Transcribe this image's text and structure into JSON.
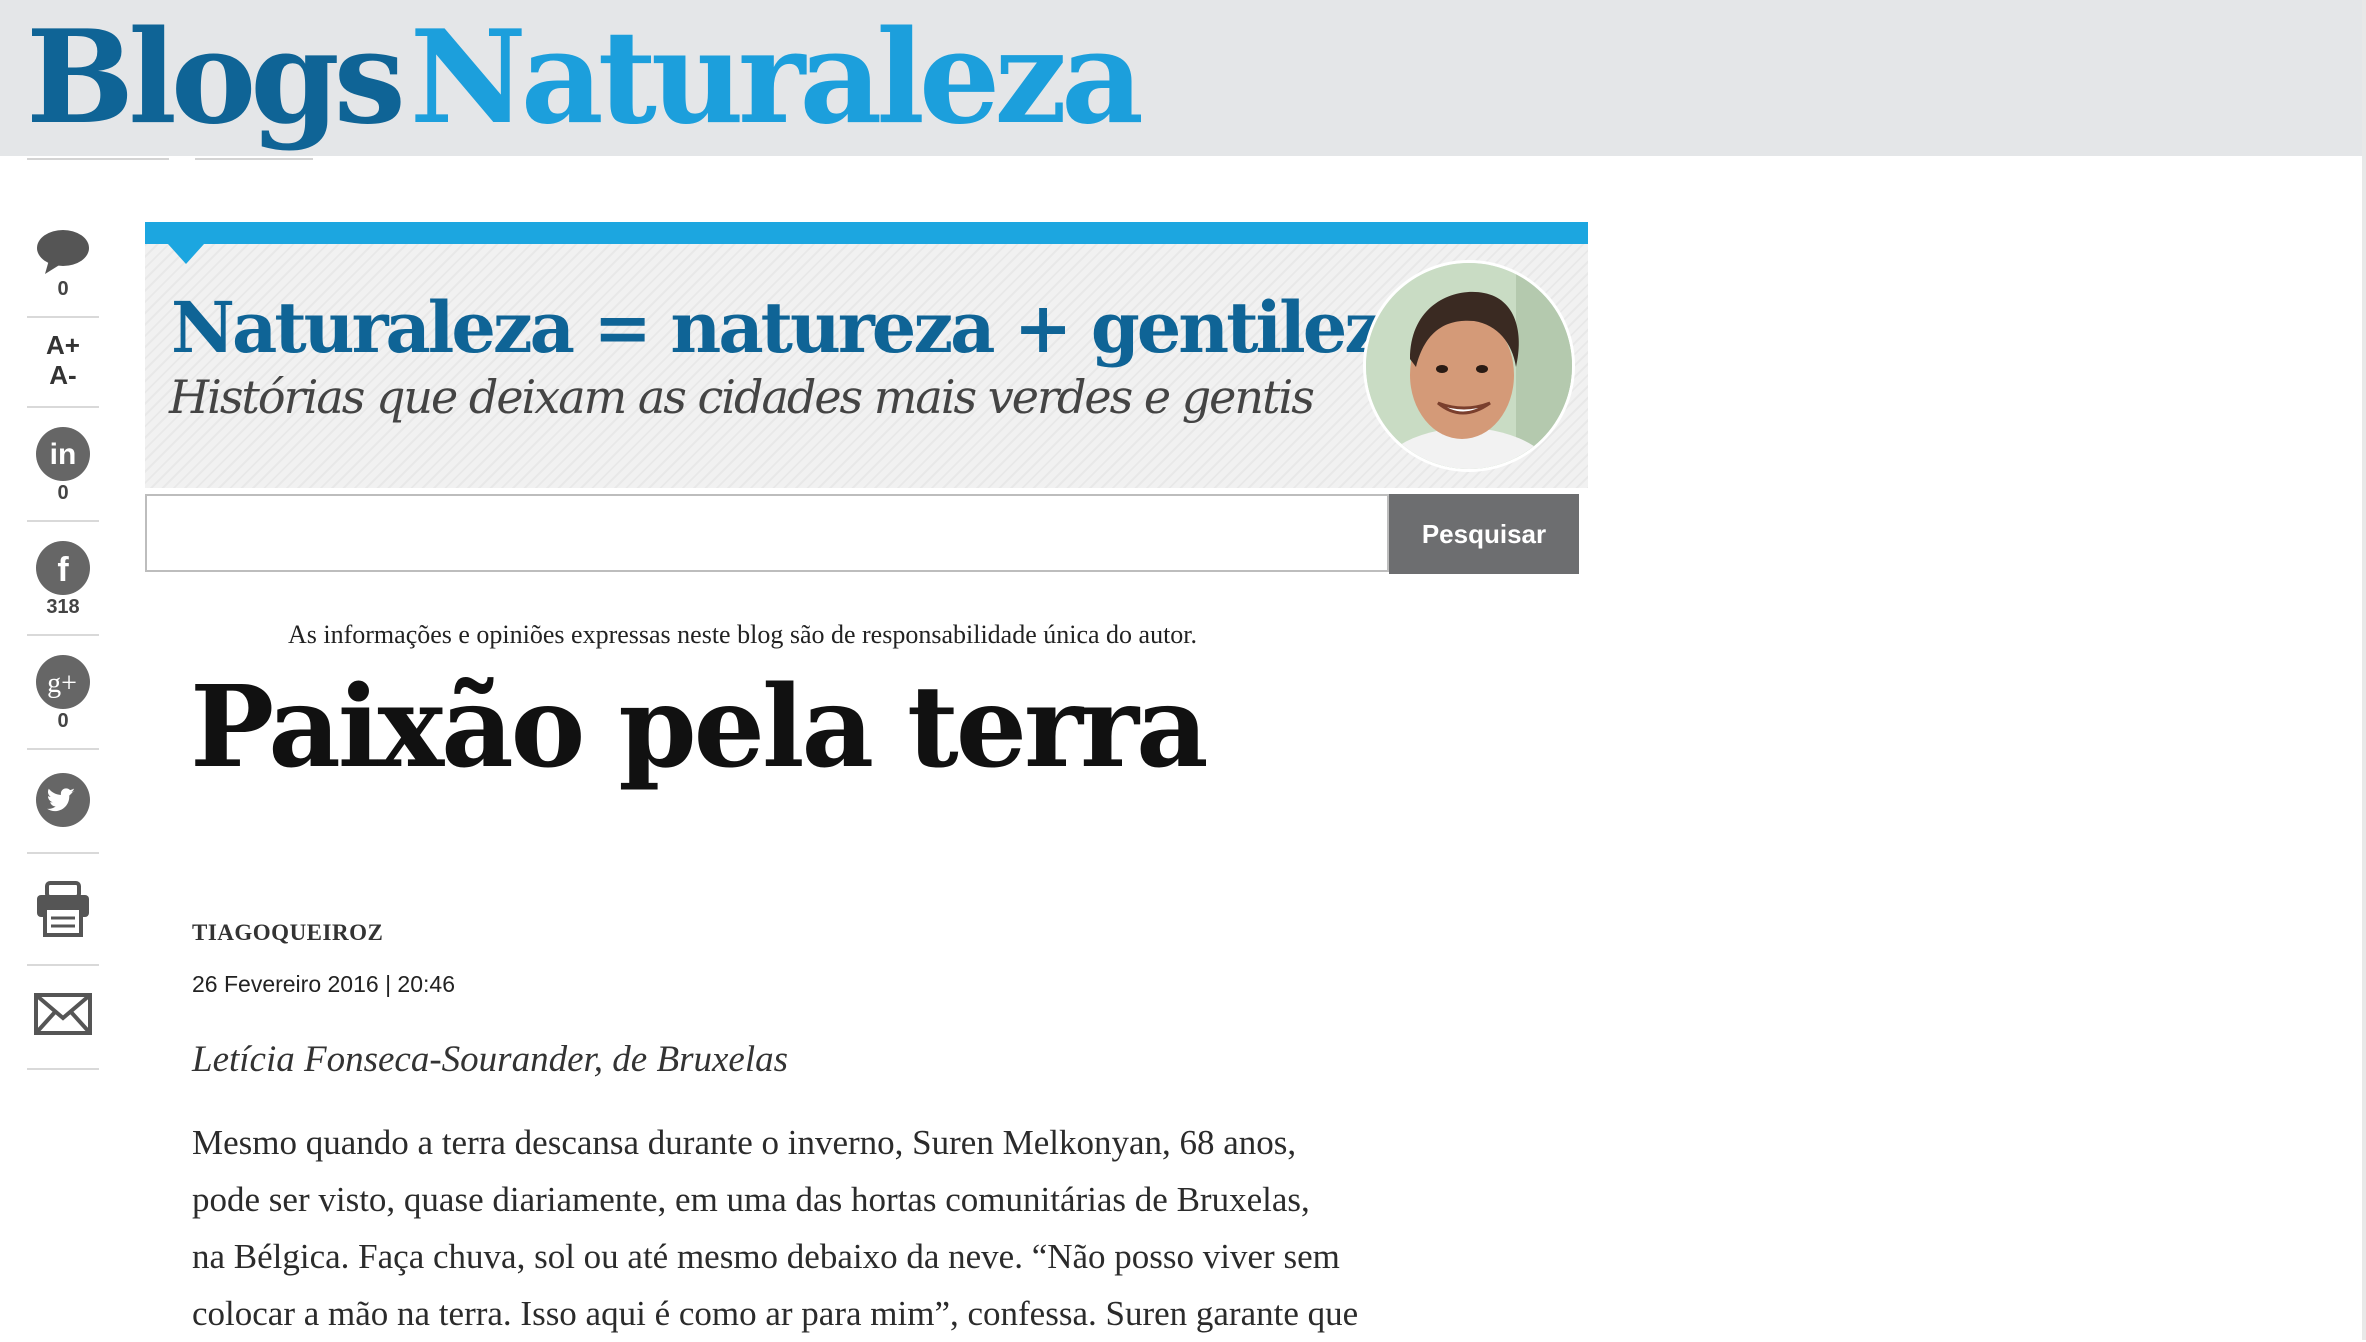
{
  "site": {
    "brand_part1": "Blogs",
    "brand_part2": "Naturaleza",
    "brand_colors": {
      "dark_blue": "#0f6496",
      "light_blue": "#1c9fdc"
    }
  },
  "sidebar": {
    "comments_count": "0",
    "font_increase": "A+",
    "font_decrease": "A-",
    "linkedin_count": "0",
    "facebook_count": "318",
    "googleplus_count": "0",
    "icons": [
      "comment-icon",
      "font-size-icon",
      "linkedin-icon",
      "facebook-icon",
      "googleplus-icon",
      "twitter-icon",
      "print-icon",
      "email-icon"
    ]
  },
  "banner": {
    "title": "Naturaleza = natureza + gentileza",
    "subtitle": "Histórias que deixam as cidades mais verdes e gentis",
    "accent_color": "#1ca6e0"
  },
  "search": {
    "value": "",
    "button_label": "Pesquisar"
  },
  "article": {
    "disclaimer": "As informações e opiniões expressas neste blog são de responsabilidade única do autor.",
    "headline": "Paixão pela terra",
    "author": "TIAGOQUEIROZ",
    "date": "26 Fevereiro 2016 | 20:46",
    "byline": "Letícia Fonseca-Sourander, de Bruxelas",
    "body_lines": [
      "Mesmo quando a terra descansa durante o inverno, Suren Melkonyan, 68 anos,",
      "pode ser visto, quase diariamente, em uma das hortas comunitárias de Bruxelas,",
      "na Bélgica. Faça chuva, sol ou até mesmo debaixo da neve. “Não posso viver sem",
      "colocar a mão na terra. Isso aqui é como ar para mim”, confessa. Suren garante que"
    ]
  }
}
